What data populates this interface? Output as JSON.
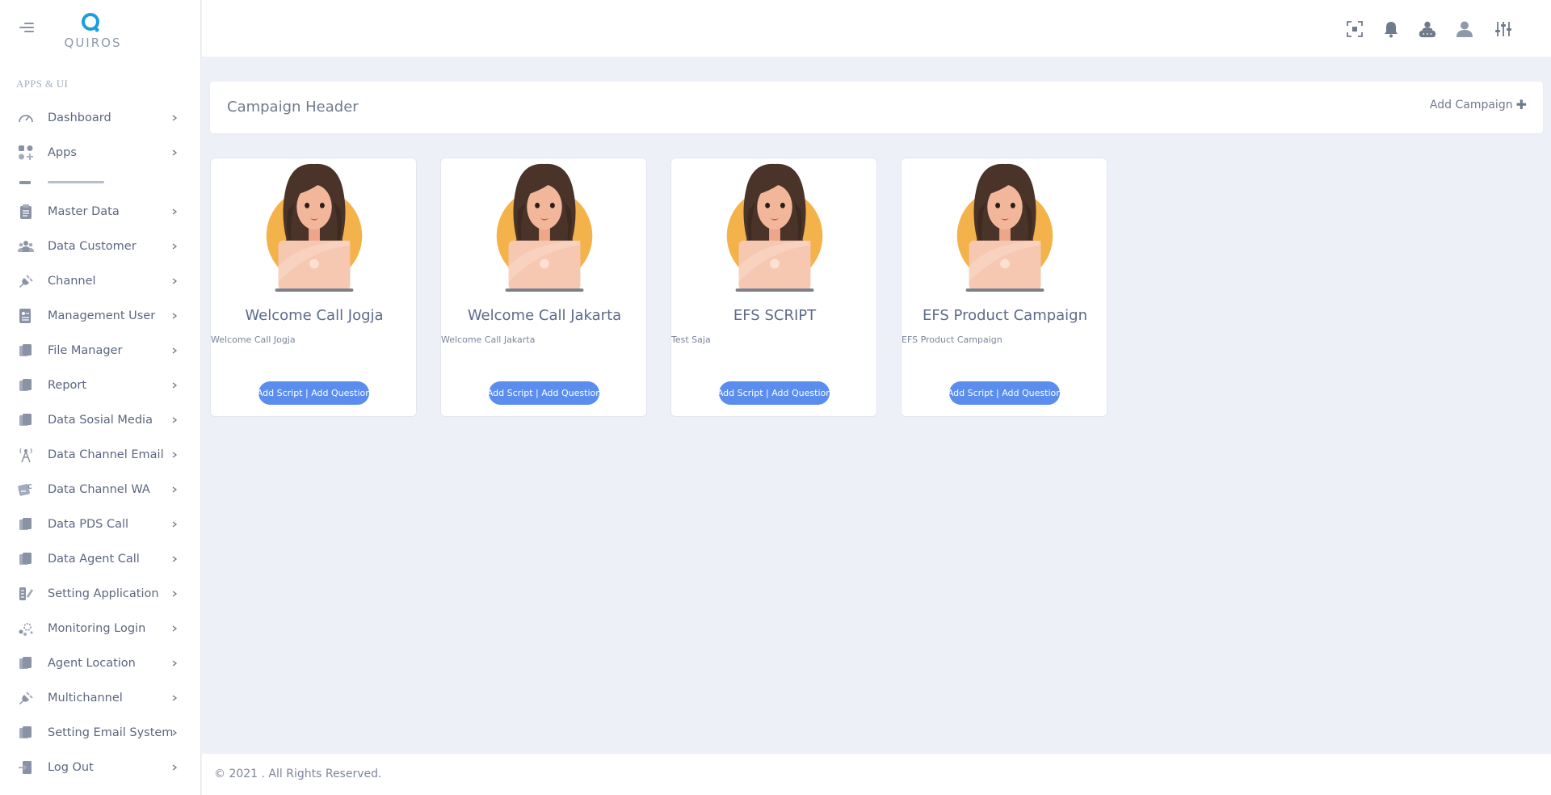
{
  "brand": {
    "logo_text": "QUIROS"
  },
  "sidebar": {
    "section_title": "APPS & UI",
    "items": [
      {
        "label": "Dashboard",
        "icon": "gauge-icon"
      },
      {
        "label": "Apps",
        "icon": "apps-grid-icon"
      },
      {
        "label": "Master Data",
        "icon": "clipboard-icon"
      },
      {
        "label": "Data Customer",
        "icon": "users-icon"
      },
      {
        "label": "Channel",
        "icon": "plug-icon"
      },
      {
        "label": "Management User",
        "icon": "user-list-icon"
      },
      {
        "label": "File Manager",
        "icon": "file-icon"
      },
      {
        "label": "Report",
        "icon": "file-icon"
      },
      {
        "label": "Data Sosial Media",
        "icon": "file-icon"
      },
      {
        "label": "Data Channel Email",
        "icon": "email-tower-icon"
      },
      {
        "label": "Data Channel WA",
        "icon": "wa-icon"
      },
      {
        "label": "Data PDS Call",
        "icon": "file-icon"
      },
      {
        "label": "Data Agent Call",
        "icon": "file-icon"
      },
      {
        "label": "Setting Application",
        "icon": "setting-pen-icon"
      },
      {
        "label": "Monitoring Login",
        "icon": "monitor-dots-icon"
      },
      {
        "label": "Agent Location",
        "icon": "file-icon"
      },
      {
        "label": "Multichannel",
        "icon": "plug-icon"
      },
      {
        "label": "Setting Email System",
        "icon": "file-icon"
      },
      {
        "label": "Log Out",
        "icon": "logout-icon"
      }
    ]
  },
  "topbar": {
    "icons": [
      "fullscreen-icon",
      "bell-icon",
      "user-lock-icon",
      "user-icon",
      "settings-sliders-icon"
    ]
  },
  "header": {
    "title": "Campaign Header",
    "add_label": "Add Campaign"
  },
  "campaigns": [
    {
      "title": "Welcome Call Jogja",
      "description": "Welcome Call Jogja",
      "button": "Add Script | Add Question"
    },
    {
      "title": "Welcome Call Jakarta",
      "description": "Welcome Call Jakarta",
      "button": "Add Script | Add Question"
    },
    {
      "title": "EFS SCRIPT",
      "description": "Test Saja",
      "button": "Add Script | Add Question"
    },
    {
      "title": "EFS Product Campaign",
      "description": "EFS Product Campaign",
      "button": "Add Script | Add Question"
    }
  ],
  "footer": {
    "text": "© 2021 . All Rights Reserved."
  },
  "colors": {
    "accent": "#5b8def",
    "sidebar_text": "#5b6780",
    "background": "#edf0f7",
    "avatar_circle": "#f4b24a"
  }
}
